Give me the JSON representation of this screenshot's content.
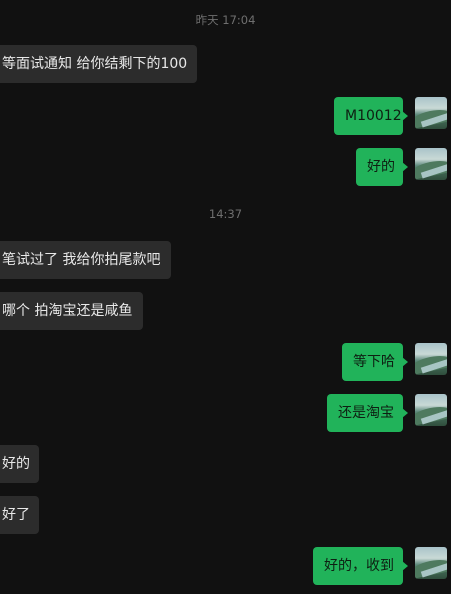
{
  "timestamps": [
    "昨天 17:04",
    "14:37"
  ],
  "messages": [
    {
      "dir": "in",
      "text": "等面试通知 给你结剩下的100"
    },
    {
      "dir": "out",
      "text": "M10012"
    },
    {
      "dir": "out",
      "text": "好的"
    },
    {
      "dir": "in",
      "text": "笔试过了 我给你拍尾款吧"
    },
    {
      "dir": "in",
      "text": "哪个 拍淘宝还是咸鱼"
    },
    {
      "dir": "out",
      "text": "等下哈"
    },
    {
      "dir": "out",
      "text": "还是淘宝"
    },
    {
      "dir": "in",
      "text": "好的"
    },
    {
      "dir": "in",
      "text": "好了"
    },
    {
      "dir": "out",
      "text": "好的，收到"
    }
  ]
}
